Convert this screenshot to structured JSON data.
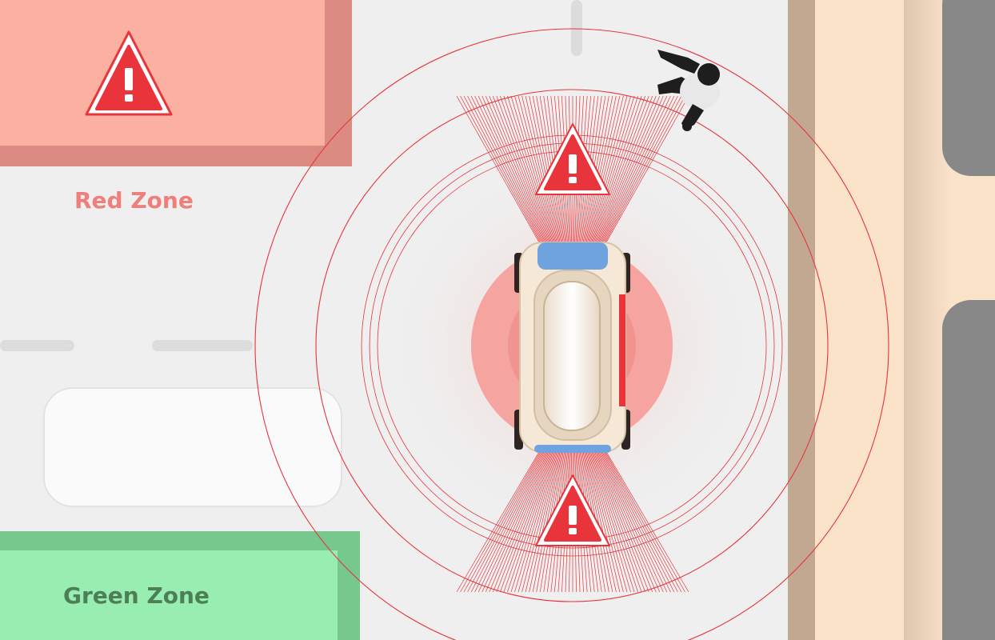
{
  "zones": {
    "red": {
      "label": "Red Zone",
      "color": "#ee7f7a"
    },
    "green": {
      "label": "Green Zone",
      "color": "#4d7f57"
    }
  },
  "alerts": [
    {
      "icon": "warning-icon",
      "symbol": "!"
    },
    {
      "icon": "warning-icon",
      "symbol": "!"
    },
    {
      "icon": "warning-icon",
      "symbol": "!"
    }
  ],
  "colors": {
    "warning": "#e8343a",
    "road": "#efefef",
    "sidewalk": "#fbe3ca",
    "curb": "#c2a891",
    "building": "#888888",
    "red_zone_fill": "#fbb0a2",
    "green_zone_fill": "#98edb0"
  }
}
